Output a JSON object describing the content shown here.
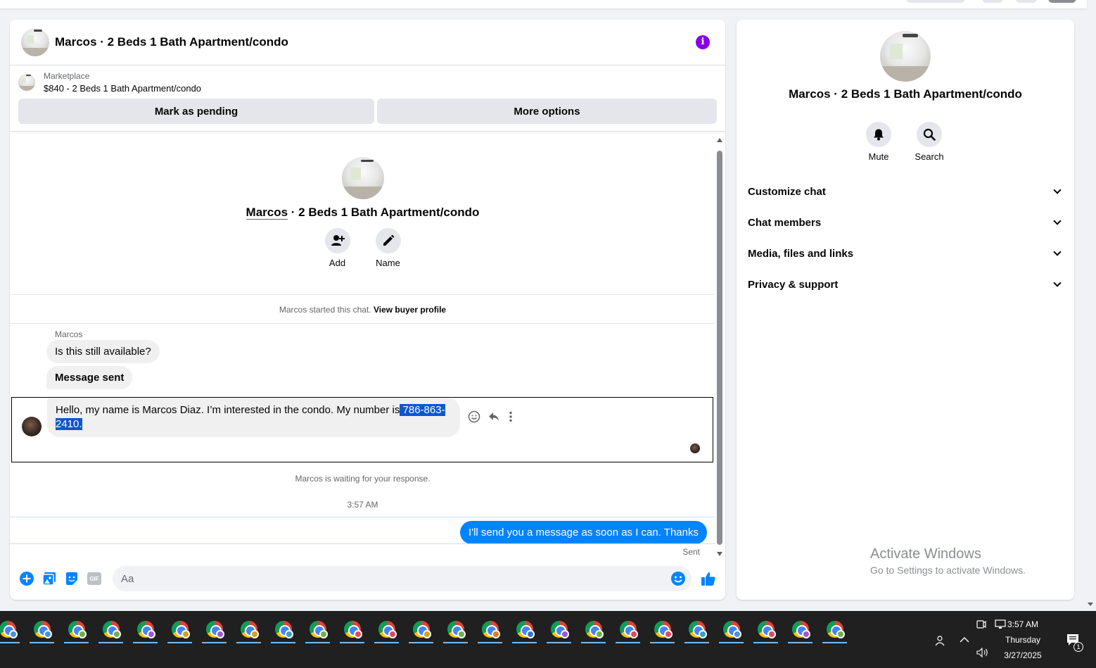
{
  "chat": {
    "title": "Marcos · 2 Beds 1 Bath Apartment/condo",
    "marketplace_label": "Marketplace",
    "listing": "$840 - 2 Beds 1 Bath Apartment/condo",
    "mark_pending": "Mark as pending",
    "more_options": "More options"
  },
  "intro": {
    "name": "Marcos",
    "title_rest": " · 2 Beds 1 Bath Apartment/condo",
    "add_label": "Add",
    "name_label": "Name"
  },
  "started": {
    "text": "Marcos started this chat. ",
    "link": "View buyer profile"
  },
  "messages": {
    "sender": "Marcos",
    "m1": "Is this still available?",
    "m2": "Message sent",
    "m3_plain": "Hello, my name is Marcos Diaz. I’m interested in the condo. My number is",
    "m3_selected": " 786-863-2410.",
    "waiting": "Marcos is waiting for your response.",
    "time": "3:57 AM",
    "outgoing": "I'll send you a message as soon as I can. Thanks",
    "sent": "Sent"
  },
  "composer": {
    "placeholder": "Aa",
    "gif": "GIF"
  },
  "info": {
    "title": "Marcos · 2 Beds 1 Bath Apartment/condo",
    "mute": "Mute",
    "search": "Search",
    "sections": [
      "Customize chat",
      "Chat members",
      "Media, files and links",
      "Privacy & support"
    ]
  },
  "watermark": {
    "line1": "Activate Windows",
    "line2": "Go to Settings to activate Windows."
  },
  "taskbar": {
    "time": "3:57 AM",
    "day": "Thursday",
    "date": "3/27/2025",
    "notif_count": "1",
    "badge_colors": [
      "#4a8fe0",
      "#4a8fe0",
      "#6cb04c",
      "#6cb04c",
      "#9b59d0",
      "#d4a020",
      "#9b59d0",
      "#d4a020",
      "#3aa0c0",
      "#6cb04c",
      "#e04a5a",
      "#e04a5a",
      "#d4a020",
      "#6cb04c",
      "#e07a20",
      "#3a6fd0",
      "#9b59d0",
      "#6cb04c",
      "#e04a5a",
      "#e04a5a",
      "#3aa0c0",
      "#4a8fe0",
      "#e04a5a",
      "#9b59d0",
      "#6cb04c"
    ]
  },
  "colors": {
    "accent": "#0084ff",
    "info_purple": "#8a00e6",
    "selection": "#0b57d0"
  }
}
